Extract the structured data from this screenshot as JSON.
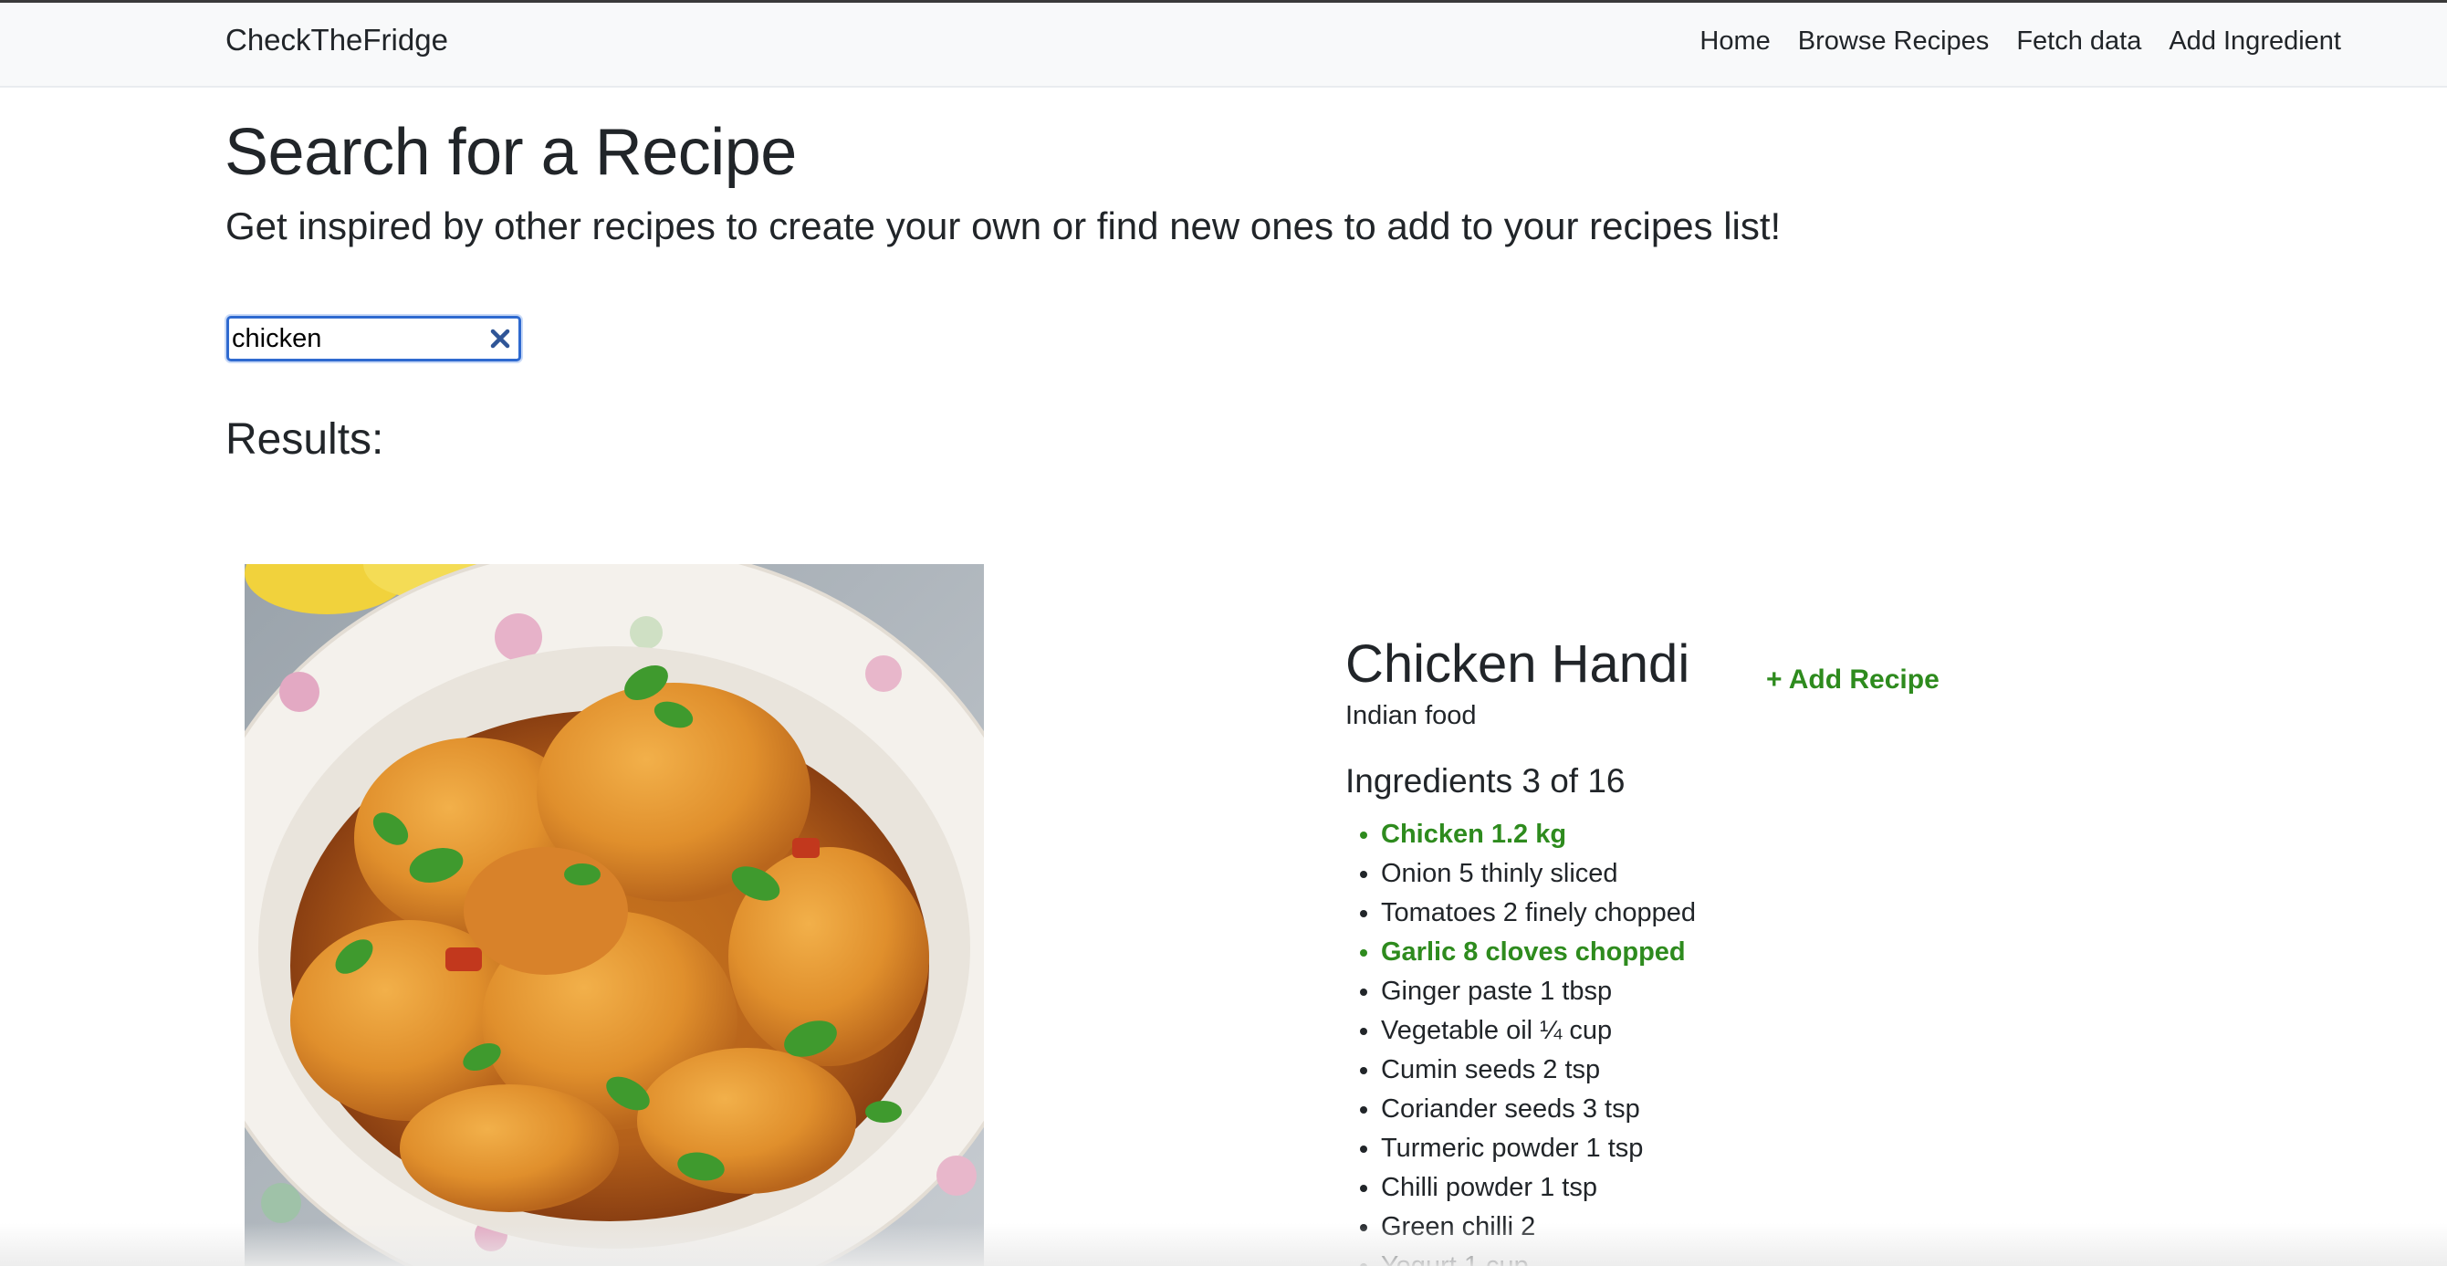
{
  "navbar": {
    "brand": "CheckTheFridge",
    "links": [
      "Home",
      "Browse Recipes",
      "Fetch data",
      "Add Ingredient"
    ]
  },
  "header": {
    "title": "Search for a Recipe",
    "subtitle": "Get inspired by other recipes to create your own or find new ones to add to your recipes list!"
  },
  "search": {
    "value": "chicken",
    "clear_icon": "close-icon"
  },
  "results": {
    "heading": "Results:"
  },
  "recipe": {
    "name": "Chicken Handi",
    "cuisine": "Indian food",
    "add_label": "+ Add Recipe",
    "ingredients_heading": "Ingredients 3 of 16",
    "ingredients": [
      {
        "text": "Chicken 1.2 kg",
        "have": true
      },
      {
        "text": "Onion 5 thinly sliced",
        "have": false
      },
      {
        "text": "Tomatoes 2 finely chopped",
        "have": false
      },
      {
        "text": "Garlic 8 cloves chopped",
        "have": true
      },
      {
        "text": "Ginger paste 1 tbsp",
        "have": false
      },
      {
        "text": "Vegetable oil ¼ cup",
        "have": false
      },
      {
        "text": "Cumin seeds 2 tsp",
        "have": false
      },
      {
        "text": "Coriander seeds 3 tsp",
        "have": false
      },
      {
        "text": "Turmeric powder 1 tsp",
        "have": false
      },
      {
        "text": "Chilli powder 1 tsp",
        "have": false
      },
      {
        "text": "Green chilli 2",
        "have": false
      },
      {
        "text": "Yogurt 1 cup",
        "have": false
      }
    ]
  },
  "colors": {
    "accent_green": "#2e8b1e",
    "focus_blue": "#2f6ad0",
    "text": "#212529",
    "navbar_bg": "#f8f9fa"
  }
}
